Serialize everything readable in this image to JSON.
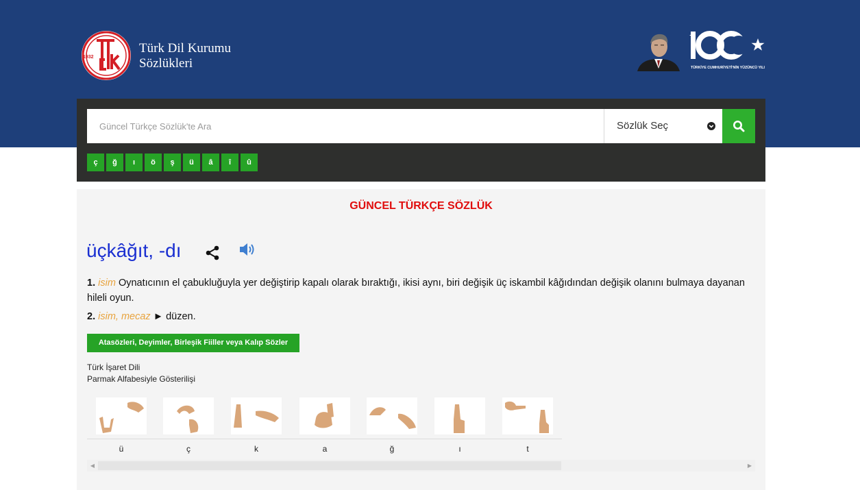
{
  "header": {
    "brand_line1": "Türk Dil Kurumu",
    "brand_line2": "Sözlükleri",
    "logo_year": "1932",
    "anniversary_caption": "TÜRKİYE CUMHURİYETİ'NİN YÜZÜNCÜ YILI"
  },
  "search": {
    "placeholder": "Güncel Türkçe Sözlük'te Ara",
    "dictionary_select_label": "Sözlük Seç",
    "special_chars": [
      "ç",
      "ğ",
      "ı",
      "ö",
      "ş",
      "ü",
      "â",
      "î",
      "û"
    ]
  },
  "entry": {
    "dictionary_title": "GÜNCEL TÜRKÇE SÖZLÜK",
    "headword": "üçkâğıt, -dı",
    "meanings": [
      {
        "num": "1.",
        "pos": "isim",
        "text": "Oynatıcının el çabukluğuyla yer değiştirip kapalı olarak bıraktığı, ikisi aynı, biri değişik üç iskambil kâğıdından değişik olanını bulmaya dayanan hileli oyun."
      },
      {
        "num": "2.",
        "pos": "isim, mecaz",
        "text": "► düzen."
      }
    ],
    "idioms_button": "Atasözleri, Deyimler, Birleşik Fiiller veya Kalıp Sözler"
  },
  "sign_language": {
    "label1": "Türk İşaret Dili",
    "label2": "Parmak Alfabesiyle Gösterilişi",
    "letters": [
      "ü",
      "ç",
      "k",
      "a",
      "ğ",
      "ı",
      "t"
    ]
  },
  "colors": {
    "header_bg": "#1e3f7a",
    "search_panel_bg": "#2e2f2d",
    "accent_green": "#2eaf2e",
    "title_red": "#e00d0d",
    "headword_blue": "#1a2fd1",
    "pos_orange": "#e8a33d"
  }
}
